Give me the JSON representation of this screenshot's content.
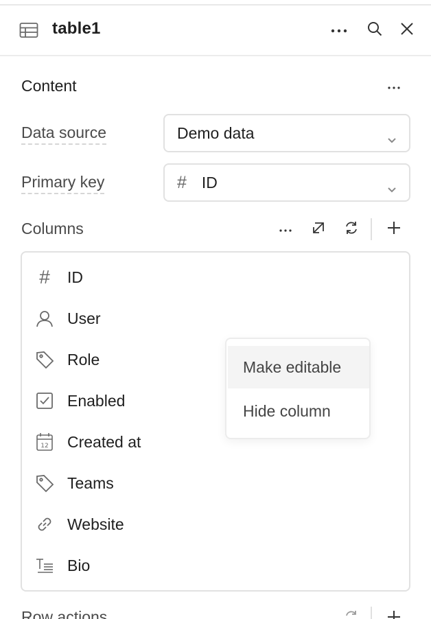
{
  "header": {
    "title": "table1",
    "icons": [
      "table-icon",
      "more-horizontal-icon",
      "search-icon",
      "close-icon"
    ]
  },
  "content": {
    "section_title": "Content",
    "data_source": {
      "label": "Data source",
      "value": "Demo data"
    },
    "primary_key": {
      "label": "Primary key",
      "value": "ID",
      "icon": "hash-icon"
    }
  },
  "columns": {
    "title": "Columns",
    "items": [
      {
        "label": "ID",
        "icon": "hash-icon"
      },
      {
        "label": "User",
        "icon": "user-icon"
      },
      {
        "label": "Role",
        "icon": "tag-icon"
      },
      {
        "label": "Enabled",
        "icon": "checkbox-icon"
      },
      {
        "label": "Created at",
        "icon": "calendar-icon"
      },
      {
        "label": "Teams",
        "icon": "tag-icon"
      },
      {
        "label": "Website",
        "icon": "link-icon"
      },
      {
        "label": "Bio",
        "icon": "text-icon"
      }
    ]
  },
  "context_menu": {
    "items": [
      "Make editable",
      "Hide column"
    ]
  },
  "row_actions": {
    "title": "Row actions"
  },
  "colors": {
    "text": "#1f1f1f",
    "muted": "#4a4a4a",
    "border": "#e1e1e1",
    "icon": "#6a6a6a",
    "hover": "#f4f4f4"
  }
}
